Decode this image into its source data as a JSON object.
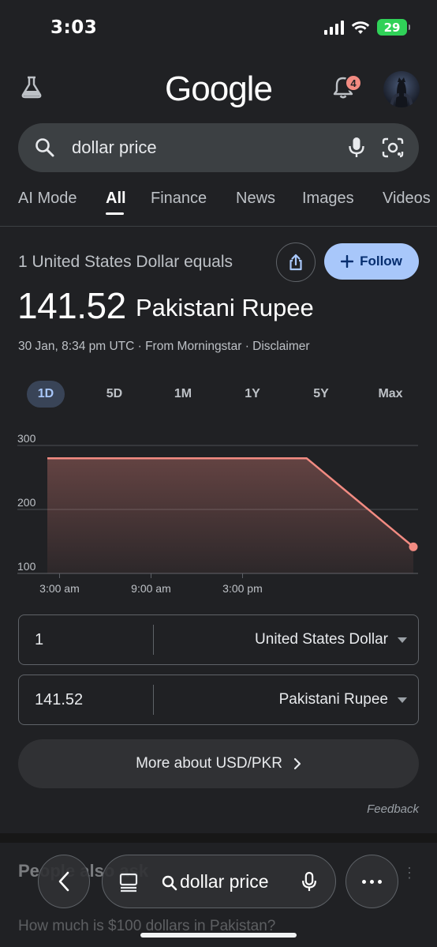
{
  "status_bar": {
    "time": "3:03",
    "battery": "29",
    "icons": [
      "signal-icon",
      "wifi-icon",
      "battery-charging-icon"
    ]
  },
  "header": {
    "logo": "Google",
    "notification_count": "4",
    "icons": [
      "labs-flask-icon",
      "bell-icon",
      "avatar"
    ]
  },
  "search": {
    "query": "dollar price",
    "icons": [
      "search-icon",
      "mic-icon",
      "lens-icon"
    ]
  },
  "tabs": [
    {
      "label": "AI Mode",
      "active": false
    },
    {
      "label": "All",
      "active": true
    },
    {
      "label": "Finance",
      "active": false
    },
    {
      "label": "News",
      "active": false
    },
    {
      "label": "Images",
      "active": false
    },
    {
      "label": "Videos",
      "active": false
    }
  ],
  "converter_card": {
    "equals_label": "1 United States Dollar equals",
    "follow_label": "Follow",
    "rate_value": "141.52",
    "rate_currency": "Pakistani Rupee",
    "meta": "30 Jan, 8:34 pm UTC · From Morningstar · Disclaimer",
    "ranges": [
      {
        "label": "1D",
        "active": true
      },
      {
        "label": "5D",
        "active": false
      },
      {
        "label": "1M",
        "active": false
      },
      {
        "label": "1Y",
        "active": false
      },
      {
        "label": "5Y",
        "active": false
      },
      {
        "label": "Max",
        "active": false
      }
    ],
    "from": {
      "amount": "1",
      "currency": "United States Dollar"
    },
    "to": {
      "amount": "141.52",
      "currency": "Pakistani Rupee"
    },
    "more_label": "More about USD/PKR",
    "feedback": "Feedback"
  },
  "chart_data": {
    "type": "area",
    "x": [
      0,
      17,
      24
    ],
    "values": [
      280,
      280,
      141.52
    ],
    "y_ticks": [
      "300",
      "200",
      "100"
    ],
    "x_ticks": [
      "3:00 am",
      "9:00 am",
      "3:00 pm"
    ],
    "ylim": [
      100,
      300
    ],
    "line_color": "#f28b82",
    "grid": true
  },
  "people_also_ask": {
    "title": "People also ask",
    "question": "How much is $100 dollars in Pakistan?"
  },
  "bottom_bar": {
    "query": "dollar price",
    "icons": [
      "back-icon",
      "tabs-icon",
      "search-icon",
      "mic-icon",
      "more-icon"
    ]
  },
  "colors": {
    "background": "#202124",
    "accent": "#a8c7fa",
    "chart_line": "#f28b82"
  }
}
